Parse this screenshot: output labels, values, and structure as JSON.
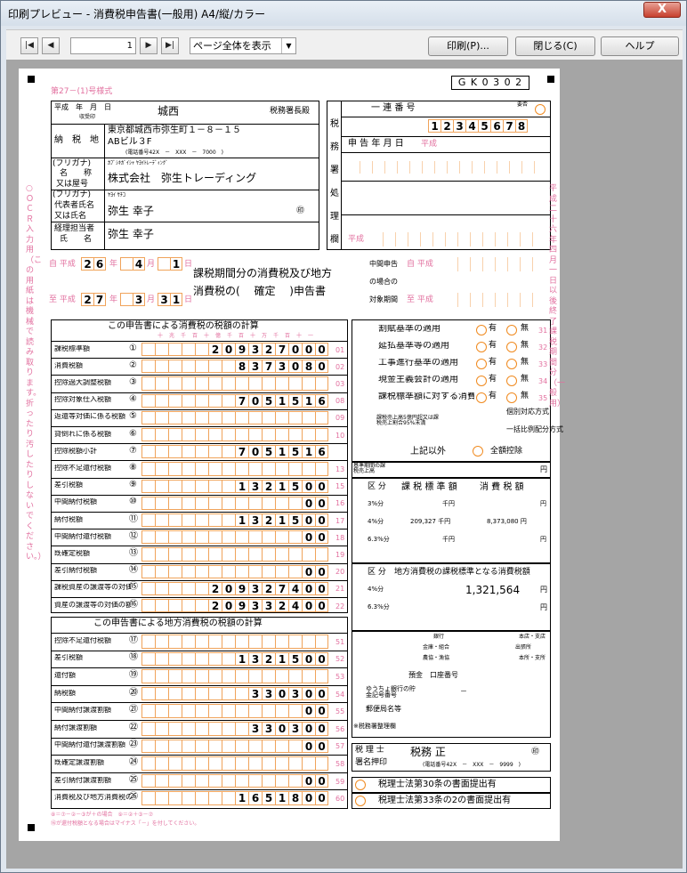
{
  "window": {
    "title": "印刷プレビュー - 消費税申告書(一般用) A4/縦/カラー",
    "close": "X"
  },
  "toolbar": {
    "first": "|◀",
    "prev": "◀",
    "page": "1",
    "next": "▶",
    "last": "▶|",
    "zoom": "ページ全体を表示",
    "print": "印刷(P)...",
    "close": "閉じる(C)",
    "help": "ヘルプ"
  },
  "form": {
    "code": "G K 0 3 0 2",
    "form_no": "第27－(1)号様式",
    "date_line": "平成　年　月　日",
    "received": "収受印",
    "office": "城西",
    "office_suffix": "税務署長殿",
    "addr_label": "納　税　地",
    "addr1": "東京都城西市弥生町１－８－１５",
    "addr2": "ABビル３F",
    "tel": "(電話番号42X　－　XXX　－　7000　)",
    "kana_label": "(フリガナ)",
    "name_label1": "名　　称",
    "name_label2": "又は屋号",
    "kana_name": "ｶﾌﾞｼｷｶﾞｲｼｬ ﾔﾖｲﾄﾚｰﾃﾞｨﾝｸﾞ",
    "company": "株式会社　弥生トレーディング",
    "kana_label2": "(フリガナ)",
    "rep_kana": "ﾔﾖｲ ｻﾁｺ",
    "rep_label1": "代表者氏名",
    "rep_label2": "又は氏名",
    "rep": "弥生 幸子",
    "seal": "㊞",
    "acct_label1": "経理担当者",
    "acct_label2": "氏　　名",
    "acct": "弥生 幸子",
    "period_from_label": "自 平成",
    "period_from": [
      "2",
      "6",
      "4",
      "1"
    ],
    "period_to_label": "至 平成",
    "period_to": [
      "2",
      "7",
      "3",
      "3",
      "1"
    ],
    "y": "年",
    "m": "月",
    "d": "日",
    "title1": "課税期間分の消費税及び地方",
    "title2": "消費税の(　 確定　 )申告書",
    "mid_label1": "中間申告",
    "mid_label2": "の場合の",
    "mid_label3": "対象期間",
    "mid_from": "自 平成",
    "mid_to": "至 平成",
    "office_use": "税務署処理欄",
    "serial": "一 連 番 号",
    "ext": "要否",
    "seiri": "1 2 3 4 5 6 7 8",
    "filing_date": "申 告 年 月 日",
    "heisei": "平成",
    "sec1_title": "この申告書による消費税の税額の計算",
    "digits": "十兆千百十億千百十万千百十一",
    "rows": [
      {
        "n": "①",
        "label": "課税標準額",
        "val": "209327000",
        "code": "01"
      },
      {
        "n": "②",
        "label": "消費税額",
        "val": "8373080",
        "code": "02"
      },
      {
        "n": "③",
        "label": "控除過大調整税額",
        "val": "",
        "code": "03"
      },
      {
        "n": "④",
        "label": "控除対象仕入税額",
        "val": "7051516",
        "code": "08"
      },
      {
        "n": "⑤",
        "label": "返還等対価に係る税額",
        "val": "",
        "code": "09"
      },
      {
        "n": "⑥",
        "label": "貸倒れに係る税額",
        "val": "",
        "code": "10"
      },
      {
        "n": "⑦",
        "label": "控除税額小計",
        "val": "7051516",
        "code": ""
      },
      {
        "n": "⑧",
        "label": "控除不足還付税額",
        "val": "",
        "code": "13"
      },
      {
        "n": "⑨",
        "label": "差引税額",
        "val": "1321500",
        "code": "15"
      },
      {
        "n": "⑩",
        "label": "中間納付税額",
        "val": "00",
        "code": "16"
      },
      {
        "n": "⑪",
        "label": "納付税額",
        "val": "1321500",
        "code": "17"
      },
      {
        "n": "⑫",
        "label": "中間納付還付税額",
        "val": "00",
        "code": "18"
      },
      {
        "n": "⑬",
        "label": "既確定税額",
        "val": "",
        "code": "19"
      },
      {
        "n": "⑭",
        "label": "差引納付税額",
        "val": "00",
        "code": "20"
      },
      {
        "n": "⑮",
        "label": "課税資産の譲渡等の対価の額",
        "val": "209327400",
        "code": "21"
      },
      {
        "n": "⑯",
        "label": "資産の譲渡等の対価の額",
        "val": "209332400",
        "code": "22"
      }
    ],
    "sec2_title": "この申告書による地方消費税の税額の計算",
    "rows2": [
      {
        "n": "⑰",
        "label": "控除不足還付税額",
        "val": "",
        "code": "51"
      },
      {
        "n": "⑱",
        "label": "差引税額",
        "val": "1321500",
        "code": "52"
      },
      {
        "n": "⑲",
        "label": "還付額",
        "val": "",
        "code": "53"
      },
      {
        "n": "⑳",
        "label": "納税額",
        "val": "330300",
        "code": "54"
      },
      {
        "n": "㉑",
        "label": "中間納付譲渡割額",
        "val": "00",
        "code": "55"
      },
      {
        "n": "㉒",
        "label": "納付譲渡割額",
        "val": "330300",
        "code": "56"
      },
      {
        "n": "㉓",
        "label": "中間納付還付譲渡割額",
        "val": "00",
        "code": "57"
      },
      {
        "n": "㉔",
        "label": "既確定譲渡割額",
        "val": "",
        "code": "58"
      },
      {
        "n": "㉕",
        "label": "差引納付譲渡割額",
        "val": "00",
        "code": "59"
      },
      {
        "n": "㉖",
        "label": "消費税及び地方消費税の合計(納付又は還付)税額",
        "val": "1651800",
        "code": "60"
      }
    ],
    "notes": "⑧＝⑦－②－③が＋の場合　⑨＝②＋③－⑦",
    "notes2": "⑯が還付税額となる場合はマイナス「－」を付してください。",
    "side_right": [
      {
        "label": "割賦基準の適用",
        "code": "31"
      },
      {
        "label": "延払基準等の適用",
        "code": "32"
      },
      {
        "label": "工事進行基準の適用",
        "code": "33"
      },
      {
        "label": "現金主義会計の適用",
        "code": "34"
      },
      {
        "label": "課税標準額に対する消費税額の計算の特例の適用",
        "code": "35"
      }
    ],
    "yes": "有",
    "no": "無",
    "kojo1": "個別対応方式",
    "kojo2": "一括比例配分方式",
    "kojo_a": "課税売上高5億円超又は課税売上割合95%未満",
    "kojo_b": "上記以外",
    "zengaku": "全額控除",
    "base_label": "基準期間の課税売上高",
    "yen": "円",
    "t1_h1": "区 分",
    "t1_h2": "課 税 標 準 額",
    "t1_h3": "消 費 税 額",
    "t1_r1": "3%分",
    "t1_r2": "4%分",
    "t1_r3": "6.3%分",
    "t1_v2a": "209,327 千円",
    "t1_v2b": "8,373,080 円",
    "t1_unit": "千円",
    "t2_h1": "区 分",
    "t2_h2": "地方消費税の課税標準となる消費税額",
    "t2_r1": "4%分",
    "t2_r2": "6.3%分",
    "t2_v1": "1,321,564",
    "bank1": "銀行",
    "bank2": "本店・支店",
    "bank3": "金庫・組合",
    "bank4": "出張所",
    "bank5": "農協・漁協",
    "bank6": "本所・支所",
    "yokin": "預金",
    "koza": "口座番号",
    "yucho": "ゆうちょ銀行の貯金記号番号",
    "post": "郵便局名等",
    "dash": "－",
    "zeimu_bango": "※税務署整理欄",
    "tax_acct_label1": "税 理 士",
    "tax_acct_label2": "署名押印",
    "tax_acct": "税務 正",
    "tax_acct_tel": "(電話番号42X　－　XXX　－　9999　)",
    "art30": "税理士法第30条の書面提出有",
    "art33": "税理士法第33条の2の書面提出有",
    "side_left": "○ＯＣＲ入力用（この用紙は機械で読み取ります。折ったり汚したりしないでください。）",
    "side_right_text": "平成二十六年四月一日以後終了課税期間分（一般用）"
  }
}
